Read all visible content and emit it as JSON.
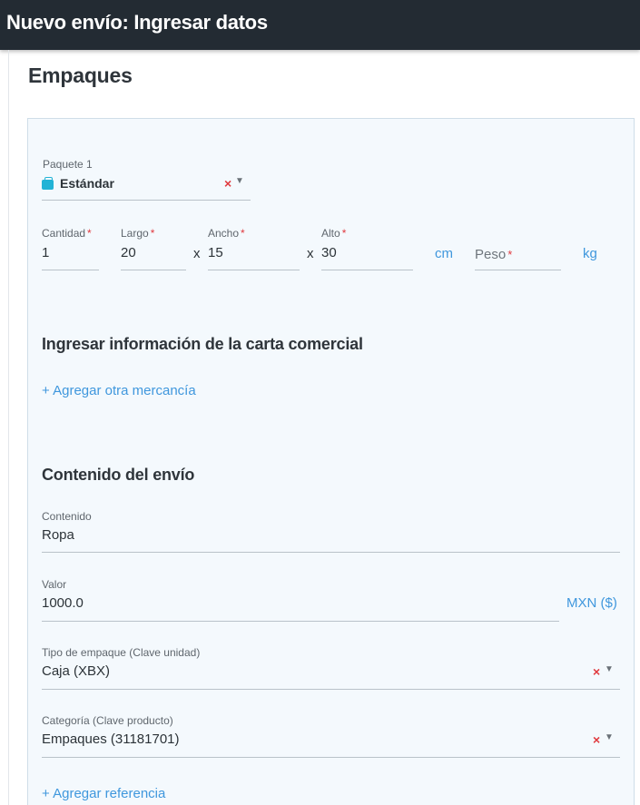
{
  "header": {
    "title": "Nuevo envío: Ingresar datos"
  },
  "section": {
    "title": "Empaques"
  },
  "package": {
    "label": "Paquete 1",
    "type_value": "Estándar",
    "clear_symbol": "×",
    "caret_symbol": "▼"
  },
  "dimensions": {
    "required_mark": "*",
    "quantity": {
      "label": "Cantidad",
      "value": "1"
    },
    "length": {
      "label": "Largo",
      "value": "20"
    },
    "width": {
      "label": "Ancho",
      "value": "15"
    },
    "height": {
      "label": "Alto",
      "value": "30"
    },
    "times_symbol": "x",
    "dimension_unit": "cm",
    "weight": {
      "placeholder": "Peso",
      "value": ""
    },
    "weight_unit": "kg"
  },
  "commercial": {
    "title": "Ingresar información de la carta comercial",
    "add_item_link": "+ Agregar otra mercancía"
  },
  "contents": {
    "title": "Contenido del envío",
    "content": {
      "label": "Contenido",
      "value": "Ropa"
    },
    "value": {
      "label": "Valor",
      "value": "1000.0",
      "currency": "MXN ($)"
    },
    "packaging_type": {
      "label": "Tipo de empaque (Clave unidad)",
      "value": "Caja (XBX)"
    },
    "category": {
      "label": "Categoría (Clave producto)",
      "value": "Empaques (31181701)"
    },
    "add_reference_link": "+ Agregar referencia"
  },
  "colors": {
    "topbar": "#232b33",
    "panel_bg": "#f4f9fd",
    "accent": "#3f97dd",
    "required": "#e0393e",
    "package_icon": "#22b3d6"
  },
  "icons": {
    "package": "package-icon",
    "clear": "clear-icon",
    "dropdown": "chevron-down-icon"
  }
}
